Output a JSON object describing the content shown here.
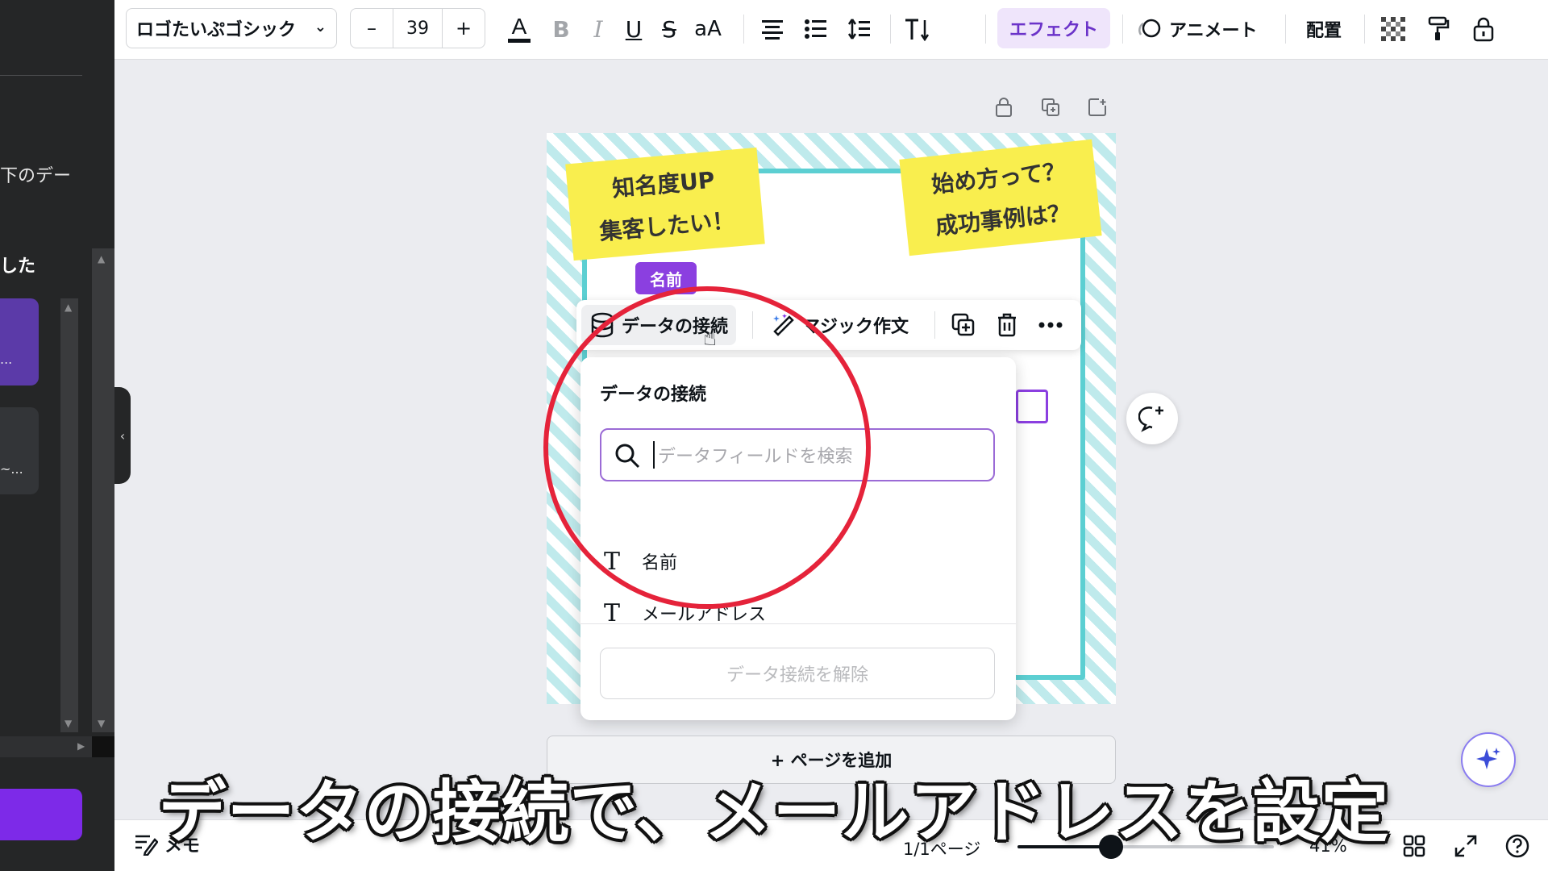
{
  "left_panel": {
    "partial_text_1": "下のデー",
    "partial_text_2": "した",
    "card_1_ellipsis": "...",
    "card_2_ellipsis": "~..."
  },
  "toolbar": {
    "font_name": "ロゴたいぷゴシック",
    "font_size": "39",
    "decrease": "–",
    "increase": "+",
    "case_label": "aA",
    "effect_label": "エフェクト",
    "animate_label": "アニメート",
    "position_label": "配置"
  },
  "canvas": {
    "note_1": [
      "知名度UP",
      "集客したい！"
    ],
    "note_2": [
      "始め方って？",
      "成功事例は？"
    ],
    "name_tag": "名前",
    "add_page": "+ ページを追加"
  },
  "context_toolbar": {
    "data_connect": "データの接続",
    "magic_write": "マジック作文"
  },
  "dropdown": {
    "title": "データの接続",
    "search_placeholder": "データフィールドを検索",
    "fields": [
      {
        "label": "名前"
      },
      {
        "label": "メールアドレス"
      }
    ],
    "disconnect": "データ接続を解除"
  },
  "bottom_bar": {
    "memo": "メモ",
    "page_count": "1/1ページ",
    "zoom": "41%",
    "zoom_value": 0.41
  },
  "subtitle": "データの接続で、メールアドレスを設定",
  "colors": {
    "accent_purple": "#8b3fe0",
    "highlight_red": "#e5233a",
    "note_yellow": "#f9ee4e",
    "frame_teal": "#5ccfd2"
  }
}
